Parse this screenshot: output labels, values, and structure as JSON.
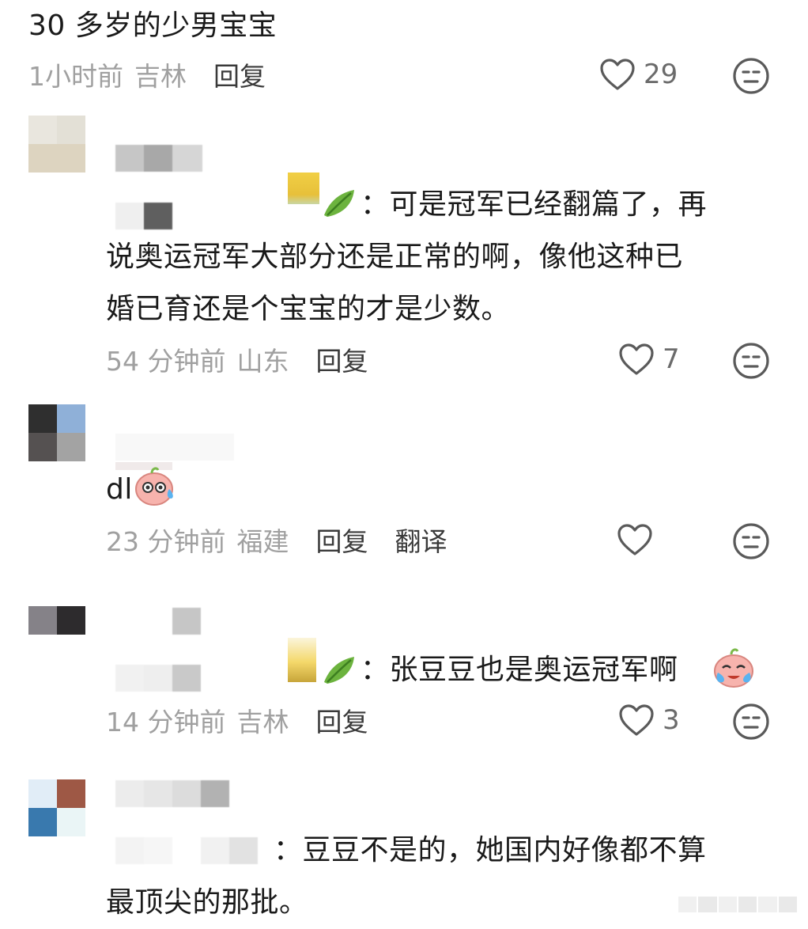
{
  "comments": [
    {
      "text": "30 多岁的少男宝宝",
      "time": "1小时前",
      "location": "吉林",
      "reply": "回复",
      "likes": "29"
    },
    {
      "prefix": "：",
      "text_line1": "可是冠军已经翻篇了，再",
      "text_line2": "说奥运冠军大部分还是正常的啊，像他这种已",
      "text_line3": "婚已育还是个宝宝的才是少数。",
      "time": "54 分钟前",
      "location": "山东",
      "reply": "回复",
      "likes": "7"
    },
    {
      "text": "dl",
      "time": "23 分钟前",
      "location": "福建",
      "reply": "回复",
      "translate": "翻译",
      "likes": ""
    },
    {
      "prefix": "：",
      "text": "张豆豆也是奥运冠军啊",
      "time": "14 分钟前",
      "location": "吉林",
      "reply": "回复",
      "likes": "3"
    },
    {
      "prefix": "：",
      "text_line1": "豆豆不是的，她国内好像都不算",
      "text_line2": "最顶尖的那批。"
    }
  ],
  "icons": {
    "like": "heart-outline-icon",
    "dislike": "neutral-face-icon",
    "leaf": "leaf-emoji",
    "sweat": "sweating-face-emoji",
    "cry": "crying-face-emoji"
  },
  "colors": {
    "meta_gray": "#a0a0a0",
    "text": "#1a1a1a",
    "reply": "#3a3a3a"
  }
}
